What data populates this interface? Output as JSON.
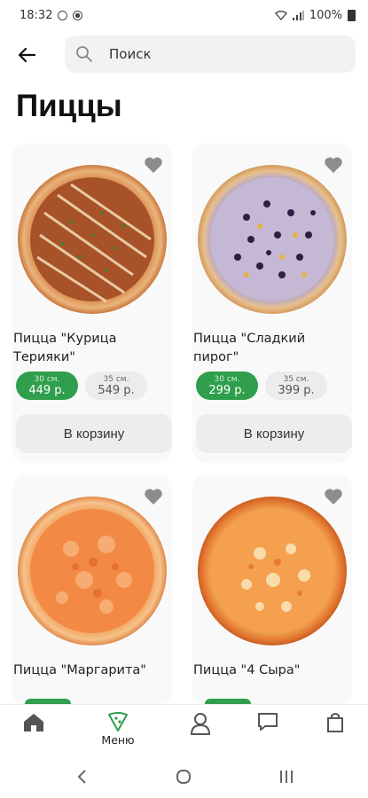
{
  "status_bar": {
    "time": "18:32",
    "battery": "100%"
  },
  "header": {
    "search_placeholder": "Поиск"
  },
  "page_title": "Пиццы",
  "products": [
    {
      "name": "Пицца \"Курица Терияки\"",
      "sizes": [
        {
          "size": "30 см.",
          "price": "449 р.",
          "selected": true
        },
        {
          "size": "35 см.",
          "price": "549 р.",
          "selected": false
        }
      ],
      "cart_label": "В корзину"
    },
    {
      "name": "Пицца \"Сладкий пирог\"",
      "sizes": [
        {
          "size": "30 см.",
          "price": "299 р.",
          "selected": true
        },
        {
          "size": "35 см.",
          "price": "399 р.",
          "selected": false
        }
      ],
      "cart_label": "В корзину"
    },
    {
      "name": "Пицца \"Маргарита\""
    },
    {
      "name": "Пицца \"4 Сыра\""
    }
  ],
  "tabbar": {
    "menu_label": "Меню"
  },
  "colors": {
    "accent": "#2f9e4d",
    "card_bg": "#f9f9f9",
    "button_bg": "#ededed"
  }
}
